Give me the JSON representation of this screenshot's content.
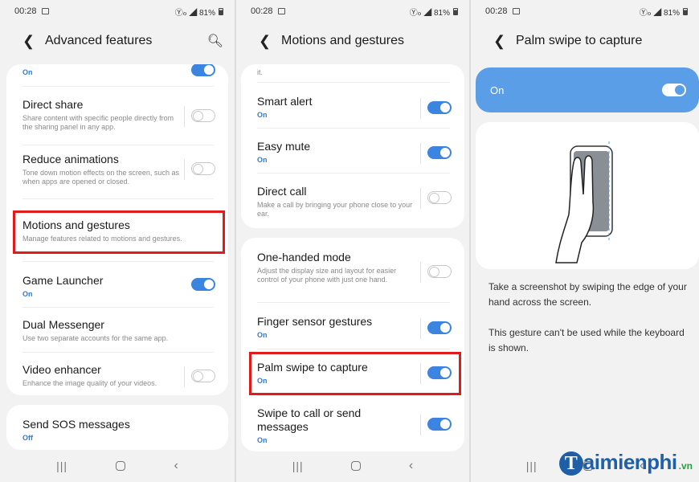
{
  "status": {
    "time": "00:28",
    "signal": "Ⓨℴ ◢ 81%"
  },
  "screen1": {
    "title": "Advanced features",
    "top_partial": {
      "sub": "On"
    },
    "items": [
      {
        "label": "Direct share",
        "sub": "Share content with specific people directly from the sharing panel in any app."
      },
      {
        "label": "Reduce animations",
        "sub": "Tone down motion effects on the screen, such as when apps are opened or closed."
      },
      {
        "label": "Motions and gestures",
        "sub": "Manage features related to motions and gestures."
      },
      {
        "label": "Game Launcher",
        "sub": "On"
      },
      {
        "label": "Dual Messenger",
        "sub": "Use two separate accounts for the same app."
      },
      {
        "label": "Video enhancer",
        "sub": "Enhance the image quality of your videos."
      },
      {
        "label": "Send SOS messages",
        "sub": "Off"
      }
    ]
  },
  "screen2": {
    "title": "Motions and gestures",
    "top_partial": "it.",
    "items": [
      {
        "label": "Smart alert",
        "sub": "On"
      },
      {
        "label": "Easy mute",
        "sub": "On"
      },
      {
        "label": "Direct call",
        "sub": "Make a call by bringing your phone close to your ear."
      },
      {
        "label": "One-handed mode",
        "sub": "Adjust the display size and layout for easier control of your phone with just one hand."
      },
      {
        "label": "Finger sensor gestures",
        "sub": "On"
      },
      {
        "label": "Palm swipe to capture",
        "sub": "On"
      },
      {
        "label": "Swipe to call or send messages",
        "sub": "On"
      }
    ]
  },
  "screen3": {
    "title": "Palm swipe to capture",
    "switch_label": "On",
    "desc1": "Take a screenshot by swiping the edge of your hand across the screen.",
    "desc2": "This gesture can't be used while the keyboard is shown."
  },
  "watermark": {
    "letter": "T",
    "rest": "aimienphi",
    "tld": ".vn"
  },
  "colors": {
    "accent": "#3b84e0",
    "highlight": "#e01b1b",
    "switch_bar": "#5b9ee8"
  }
}
